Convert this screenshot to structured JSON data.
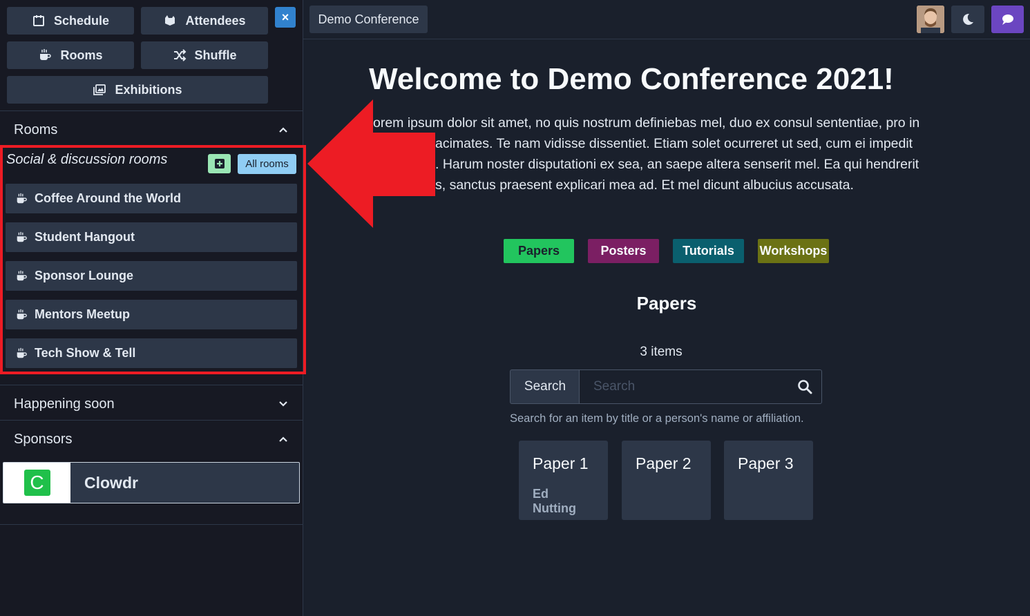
{
  "sidebar": {
    "nav": {
      "schedule": "Schedule",
      "attendees": "Attendees",
      "rooms": "Rooms",
      "shuffle": "Shuffle",
      "exhibitions": "Exhibitions",
      "close_icon": "×"
    },
    "rooms_section": {
      "title": "Rooms",
      "subheading": "Social & discussion rooms",
      "all_rooms_label": "All rooms",
      "items": [
        {
          "label": "Coffee Around the World",
          "icon": "coffee-icon"
        },
        {
          "label": "Student Hangout",
          "icon": "coffee-icon"
        },
        {
          "label": "Sponsor Lounge",
          "icon": "coffee-icon"
        },
        {
          "label": "Mentors Meetup",
          "icon": "coffee-icon"
        },
        {
          "label": "Tech Show & Tell",
          "icon": "coffee-icon"
        }
      ]
    },
    "happening_soon": {
      "title": "Happening soon"
    },
    "sponsors": {
      "title": "Sponsors",
      "items": [
        {
          "name": "Clowdr",
          "logo_letter": "C",
          "logo_color": "#20c04a"
        }
      ]
    }
  },
  "topbar": {
    "conference_label": "Demo Conference",
    "chat_color": "#6b46c1"
  },
  "main": {
    "welcome_title": "Welcome to Demo Conference 2021!",
    "lorem_lines": [
      "orem ipsum dolor sit amet, no quis nostrum definiebas mel, duo ex consul sententiae, pro in",
      "acimates. Te nam vidisse dissentiet. Etiam solet ocurreret ut sed, cum ei impedit",
      ". Harum noster disputationi ex sea, an saepe altera senserit mel. Ea qui hendrerit",
      "s, sanctus praesent explicari mea ad. Et mel dicunt albucius accusata."
    ],
    "tags": [
      {
        "label": "Papers",
        "color": "#22c55e",
        "text_color": "#1a202c"
      },
      {
        "label": "Posters",
        "color": "#7b1f63",
        "text_color": "#f7fafc"
      },
      {
        "label": "Tutorials",
        "color": "#0a5f6e",
        "text_color": "#f7fafc"
      },
      {
        "label": "Workshops",
        "color": "#6b7214",
        "text_color": "#f7fafc"
      }
    ],
    "papers_title": "Papers",
    "items_count": "3 items",
    "search": {
      "addon_label": "Search",
      "placeholder": "Search",
      "help_text": "Search for an item by title or a person's name or affiliation."
    },
    "papers": [
      {
        "title": "Paper 1",
        "author": "Ed Nutting"
      },
      {
        "title": "Paper 2",
        "author": ""
      },
      {
        "title": "Paper 3",
        "author": ""
      }
    ]
  },
  "annotation": {
    "arrow_color": "#ed1c24",
    "box_color": "#ed1c24"
  }
}
